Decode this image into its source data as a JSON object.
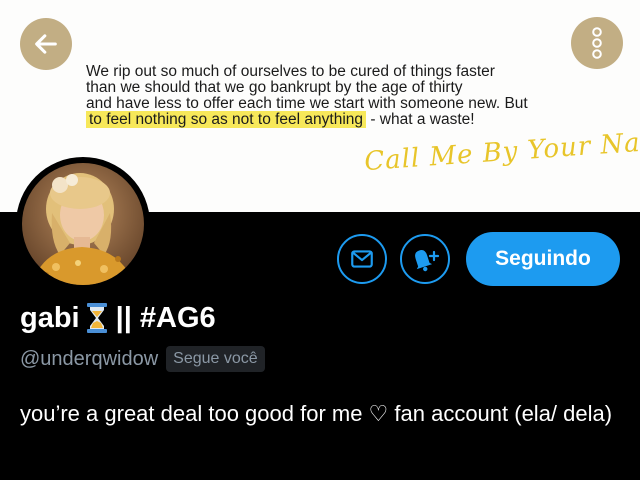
{
  "banner": {
    "quote_lines": [
      "We rip out so much of ourselves to be cured of things faster",
      "than we should that we go bankrupt by the age of thirty",
      "and have less to offer each time we start with someone new. But"
    ],
    "quote_highlight": "to feel nothing so as not to feel anything",
    "quote_tail": " - what a waste!",
    "signature": "Call Me By Your Name",
    "highlight_color": "#f7e85a",
    "signature_color": "#e8c52a"
  },
  "nav": {
    "back_icon": "arrow-left-icon",
    "more_icon": "more-vertical-icon",
    "button_color": "#c2ae84"
  },
  "profile": {
    "avatar_icon": "avatar",
    "name": "gabi",
    "name_suffix": "|| #AG6",
    "name_emoji": "hourglass-icon",
    "handle": "@underqwidow",
    "follows_you_badge": "Segue você",
    "bio": "you’re a great deal too good for me ♡ fan account (ela/ dela)"
  },
  "actions": {
    "message_icon": "mail-icon",
    "notify_icon": "bell-plus-icon",
    "follow_label": "Seguindo",
    "accent_color": "#1d9bf0"
  }
}
